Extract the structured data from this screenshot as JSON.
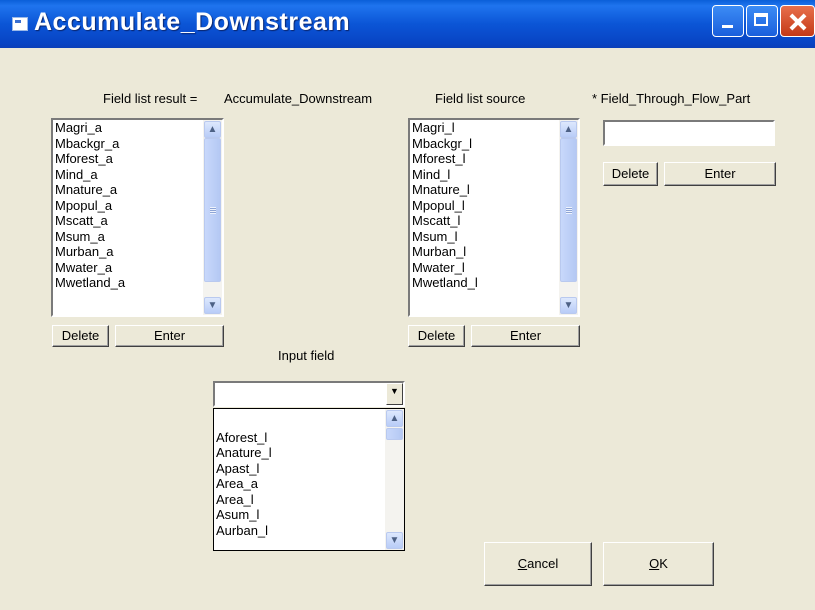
{
  "window": {
    "title": "Accumulate_Downstream"
  },
  "labels": {
    "field_list_result": "Field list result =",
    "result_value": "Accumulate_Downstream",
    "field_list_source": "Field list source",
    "field_through_flow": "* Field_Through_Flow_Part",
    "input_field": "Input field"
  },
  "result_list": {
    "items": [
      "Magri_a",
      "Mbackgr_a",
      "Mforest_a",
      "Mind_a",
      "Mnature_a",
      "Mpopul_a",
      "Mscatt_a",
      "Msum_a",
      "Murban_a",
      "Mwater_a",
      "Mwetland_a"
    ]
  },
  "source_list": {
    "items": [
      "Magri_l",
      "Mbackgr_l",
      "Mforest_l",
      "Mind_l",
      "Mnature_l",
      "Mpopul_l",
      "Mscatt_l",
      "Msum_l",
      "Murban_l",
      "Mwater_l",
      "Mwetland_l"
    ]
  },
  "input_dropdown": {
    "value": "",
    "items": [
      "",
      "Aforest_l",
      "Anature_l",
      "Apast_l",
      "Area_a",
      "Area_l",
      "Asum_l",
      "Aurban_l"
    ]
  },
  "through_flow": {
    "value": ""
  },
  "buttons": {
    "delete": "Delete",
    "enter": "Enter",
    "cancel_prefix": "C",
    "cancel_rest": "ancel",
    "ok_prefix": "O",
    "ok_rest": "K"
  },
  "icons": {
    "title": "window-app-icon",
    "scroll_up": "chevron-up-icon",
    "scroll_down": "chevron-down-icon",
    "combo": "dropdown-arrow-icon"
  }
}
